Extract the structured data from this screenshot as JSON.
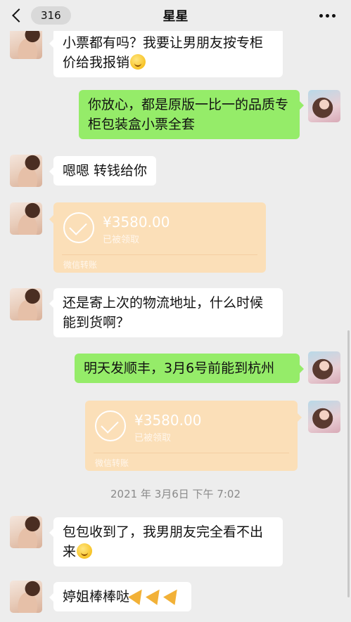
{
  "header": {
    "back_count": "316",
    "title": "星星"
  },
  "messages": [
    {
      "side": "left",
      "type": "text",
      "text": "小票都有吗？我要让男朋友按专柜价给我报销",
      "emoji": "thinking-face"
    },
    {
      "side": "right",
      "type": "text",
      "text": "你放心，都是原版一比一的品质专柜包装盒小票全套"
    },
    {
      "side": "left",
      "type": "text",
      "text": "嗯嗯 转钱给你"
    },
    {
      "side": "left",
      "type": "transfer",
      "amount": "¥3580.00",
      "status": "已被领取",
      "footer": "微信转账"
    },
    {
      "side": "left",
      "type": "text",
      "text": "还是寄上次的物流地址，什么时候能到货啊？"
    },
    {
      "side": "right",
      "type": "text",
      "text": "明天发顺丰，3月6号前能到杭州"
    },
    {
      "side": "right",
      "type": "transfer",
      "amount": "¥3580.00",
      "status": "已被领取",
      "footer": "微信转账"
    },
    {
      "side": "left",
      "type": "text",
      "text": "包包收到了，我男朋友完全看不出来",
      "emoji": "thinking-face"
    },
    {
      "side": "left",
      "type": "text",
      "text": "婷姐棒棒哒",
      "emoji": "party-popper x3"
    }
  ],
  "timestamp": "2021 年 3月6日 下午 7:02",
  "colors": {
    "background": "#ededed",
    "bubble_left": "#ffffff",
    "bubble_right": "#95ec69",
    "transfer_card": "#fbdfb8"
  }
}
